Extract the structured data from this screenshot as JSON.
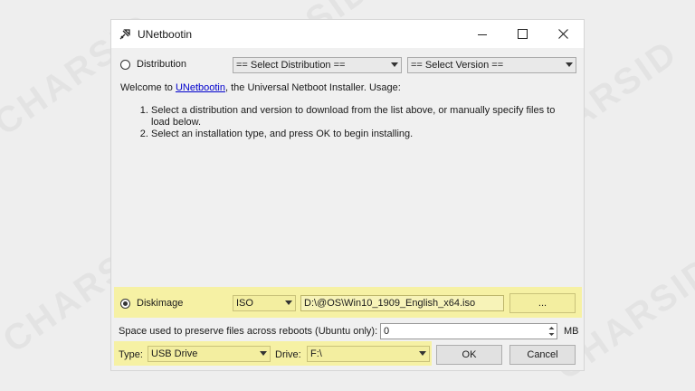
{
  "window": {
    "title": "UNetbootin"
  },
  "top": {
    "distribution_label": "Distribution",
    "distribution_select": "== Select Distribution ==",
    "version_select": "== Select Version =="
  },
  "intro": {
    "prefix": "Welcome to ",
    "link": "UNetbootin",
    "suffix": ", the Universal Netboot Installer. Usage:",
    "steps": [
      "Select a distribution and version to download from the list above, or manually specify files to load below.",
      "Select an installation type, and press OK to begin installing."
    ]
  },
  "diskimage": {
    "label": "Diskimage",
    "type_select": "ISO",
    "path": "D:\\@OS\\Win10_1909_English_x64.iso",
    "browse_label": "..."
  },
  "persist": {
    "label": "Space used to preserve files across reboots (Ubuntu only):",
    "value": "0",
    "unit": "MB"
  },
  "bottom": {
    "type_label": "Type:",
    "type_value": "USB Drive",
    "drive_label": "Drive:",
    "drive_value": "F:\\",
    "ok_label": "OK",
    "cancel_label": "Cancel"
  },
  "watermark": "CHARSID",
  "colors": {
    "highlight": "#f6f1a4",
    "link": "#0000cc"
  }
}
